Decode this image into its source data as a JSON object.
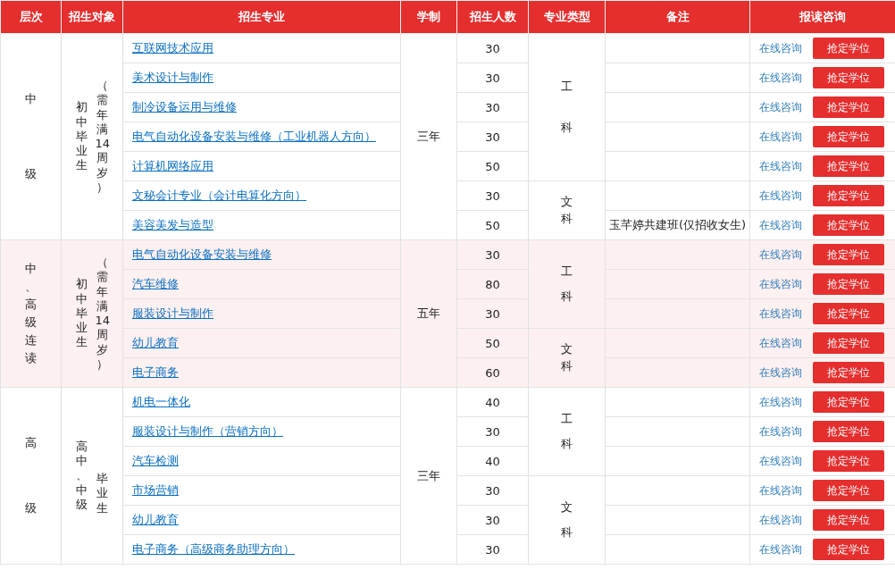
{
  "table": {
    "columns": [
      "层次",
      "招生对象",
      "招生专业",
      "学制",
      "招生人数",
      "专业类型",
      "备注",
      "报读咨询"
    ],
    "groups": [
      {
        "level": "中级",
        "audience": [
          "初中毕业生",
          "（需年满14周岁）"
        ],
        "duration": "三年",
        "tinted": false,
        "types": [
          {
            "label": "工科",
            "rows": [
              {
                "major": "互联网技术应用",
                "count": "30",
                "consult": "在线咨询",
                "action": "抢定学位"
              },
              {
                "major": "美术设计与制作",
                "count": "30",
                "consult": "在线咨询",
                "action": "抢定学位"
              },
              {
                "major": "制冷设备运用与维修",
                "count": "30",
                "consult": "在线咨询",
                "action": "抢定学位"
              },
              {
                "major": "电气自动化设备安装与维修（工业机器人方向）",
                "count": "30",
                "consult": "在线咨询",
                "action": "抢定学位"
              },
              {
                "major": "计算机网络应用",
                "count": "50",
                "consult": "在线咨询",
                "action": "抢定学位"
              }
            ]
          },
          {
            "label": "文科",
            "rows": [
              {
                "major": "文秘会计专业（会计电算化方向）",
                "count": "30",
                "consult": "在线咨询",
                "action": "抢定学位"
              },
              {
                "major": "美容美发与造型",
                "count": "50",
                "remark": "玉芊婷共建班(仅招收女生)",
                "consult": "在线咨询",
                "action": "抢定学位"
              }
            ]
          }
        ]
      },
      {
        "level": "中、高级连读",
        "audience": [
          "初中毕业生",
          "（需年满14周岁）"
        ],
        "duration": "五年",
        "tinted": true,
        "types": [
          {
            "label": "工科",
            "rows": [
              {
                "major": "电气自动化设备安装与维修",
                "count": "30",
                "consult": "在线咨询",
                "action": "抢定学位"
              },
              {
                "major": "汽车维修",
                "count": "80",
                "consult": "在线咨询",
                "action": "抢定学位"
              },
              {
                "major": "服装设计与制作",
                "count": "30",
                "consult": "在线咨询",
                "action": "抢定学位"
              }
            ]
          },
          {
            "label": "文科",
            "rows": [
              {
                "major": "幼儿教育",
                "count": "50",
                "consult": "在线咨询",
                "action": "抢定学位"
              },
              {
                "major": "电子商务",
                "count": "60",
                "consult": "在线咨询",
                "action": "抢定学位"
              }
            ]
          }
        ]
      },
      {
        "level": "高级",
        "audience": [
          "高中、中级",
          "毕业生"
        ],
        "duration": "三年",
        "tinted": false,
        "types": [
          {
            "label": "工科",
            "rows": [
              {
                "major": "机电一体化",
                "count": "40",
                "consult": "在线咨询",
                "action": "抢定学位"
              },
              {
                "major": "服装设计与制作（营销方向）",
                "count": "30",
                "consult": "在线咨询",
                "action": "抢定学位"
              },
              {
                "major": "汽车检测",
                "count": "40",
                "consult": "在线咨询",
                "action": "抢定学位"
              }
            ]
          },
          {
            "label": "文科",
            "rows": [
              {
                "major": "市场营销",
                "count": "30",
                "consult": "在线咨询",
                "action": "抢定学位"
              },
              {
                "major": "幼儿教育",
                "count": "30",
                "consult": "在线咨询",
                "action": "抢定学位"
              },
              {
                "major": "电子商务（高级商务助理方向）",
                "count": "30",
                "consult": "在线咨询",
                "action": "抢定学位"
              }
            ]
          }
        ]
      }
    ]
  }
}
